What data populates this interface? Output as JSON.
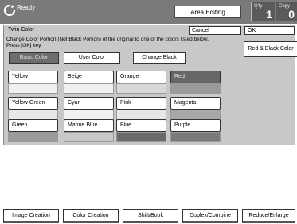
{
  "status": {
    "text": "Ready"
  },
  "header": {
    "area_editing": "Area Editing"
  },
  "counters": [
    {
      "label": "Q'ty",
      "value": "1"
    },
    {
      "label": "Copy",
      "value": "0"
    }
  ],
  "panel": {
    "title": "Twin Color",
    "cancel": "Cancel",
    "ok": "OK",
    "instruction_line1": "Change Color Portion (Not Black Portion) of the original to one of the colors listed below.",
    "instruction_line2": "Press [OK] key.",
    "modes": {
      "basic": "Basic Color",
      "user": "User Color",
      "change_black": "Change Black"
    },
    "red_black": "Red & Black Color",
    "colors": [
      {
        "label": "Yellow",
        "color": "#f0f0f0"
      },
      {
        "label": "Beige",
        "color": "#f0f0f0"
      },
      {
        "label": "Orange",
        "color": "#d8d8d8"
      },
      {
        "label": "Red",
        "color": "#9a9a9a",
        "selected": true
      },
      {
        "label": "Yellow Green",
        "color": "#e8e8e8"
      },
      {
        "label": "Cyan",
        "color": "#f0f0f0"
      },
      {
        "label": "Pink",
        "color": "#e6e6e6"
      },
      {
        "label": "Magenta",
        "color": "#a8a8a8"
      },
      {
        "label": "Green",
        "color": "#9a9a9a"
      },
      {
        "label": "Marine Blue",
        "color": "#c8c8c8"
      },
      {
        "label": "Blue",
        "color": "#6a6a6a"
      },
      {
        "label": "Purple",
        "color": "#7a7a7a"
      }
    ]
  },
  "bottom_tabs": [
    "Image Creation",
    "Color Creation",
    "Shift/Book",
    "Duplex/Combine",
    "Reduce/Enlarge"
  ]
}
